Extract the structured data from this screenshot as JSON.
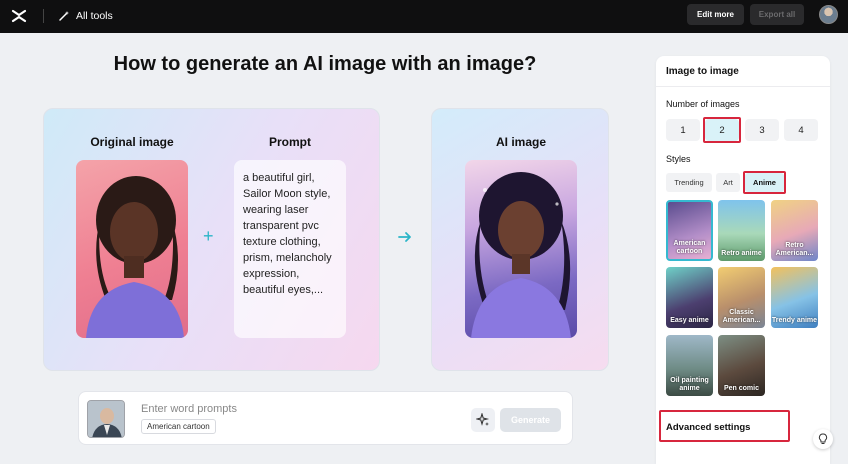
{
  "topbar": {
    "all_tools_label": "All tools",
    "edit_more_label": "Edit more",
    "export_all_label": "Export all"
  },
  "main": {
    "title": "How to generate an AI image with an image?",
    "original_label": "Original image",
    "prompt_label": "Prompt",
    "ai_label": "AI image",
    "prompt_text": "a beautiful girl, Sailor Moon style, wearing laser transparent pvc texture clothing, prism, melancholy expression, beautiful eyes,..."
  },
  "input_bar": {
    "placeholder": "Enter word prompts",
    "style_chip": "American cartoon",
    "generate_label": "Generate"
  },
  "panel": {
    "title": "Image to image",
    "number_label": "Number of images",
    "numbers": [
      "1",
      "2",
      "3",
      "4"
    ],
    "selected_number": "2",
    "styles_label": "Styles",
    "style_tabs": [
      "Trending",
      "Art",
      "Anime"
    ],
    "selected_tab": "Anime",
    "tiles": [
      {
        "label": "American cartoon",
        "selected": true
      },
      {
        "label": "Retro anime",
        "selected": false
      },
      {
        "label": "Retro American...",
        "selected": false
      },
      {
        "label": "Easy anime",
        "selected": false
      },
      {
        "label": "Classic American...",
        "selected": false
      },
      {
        "label": "Trendy anime",
        "selected": false
      },
      {
        "label": "Oil painting anime",
        "selected": false
      },
      {
        "label": "Pen comic",
        "selected": false
      }
    ],
    "advanced_label": "Advanced settings"
  },
  "colors": {
    "accent": "#35b9d0",
    "highlight_red": "#d7263d",
    "topbar_bg": "#0f0f10"
  }
}
